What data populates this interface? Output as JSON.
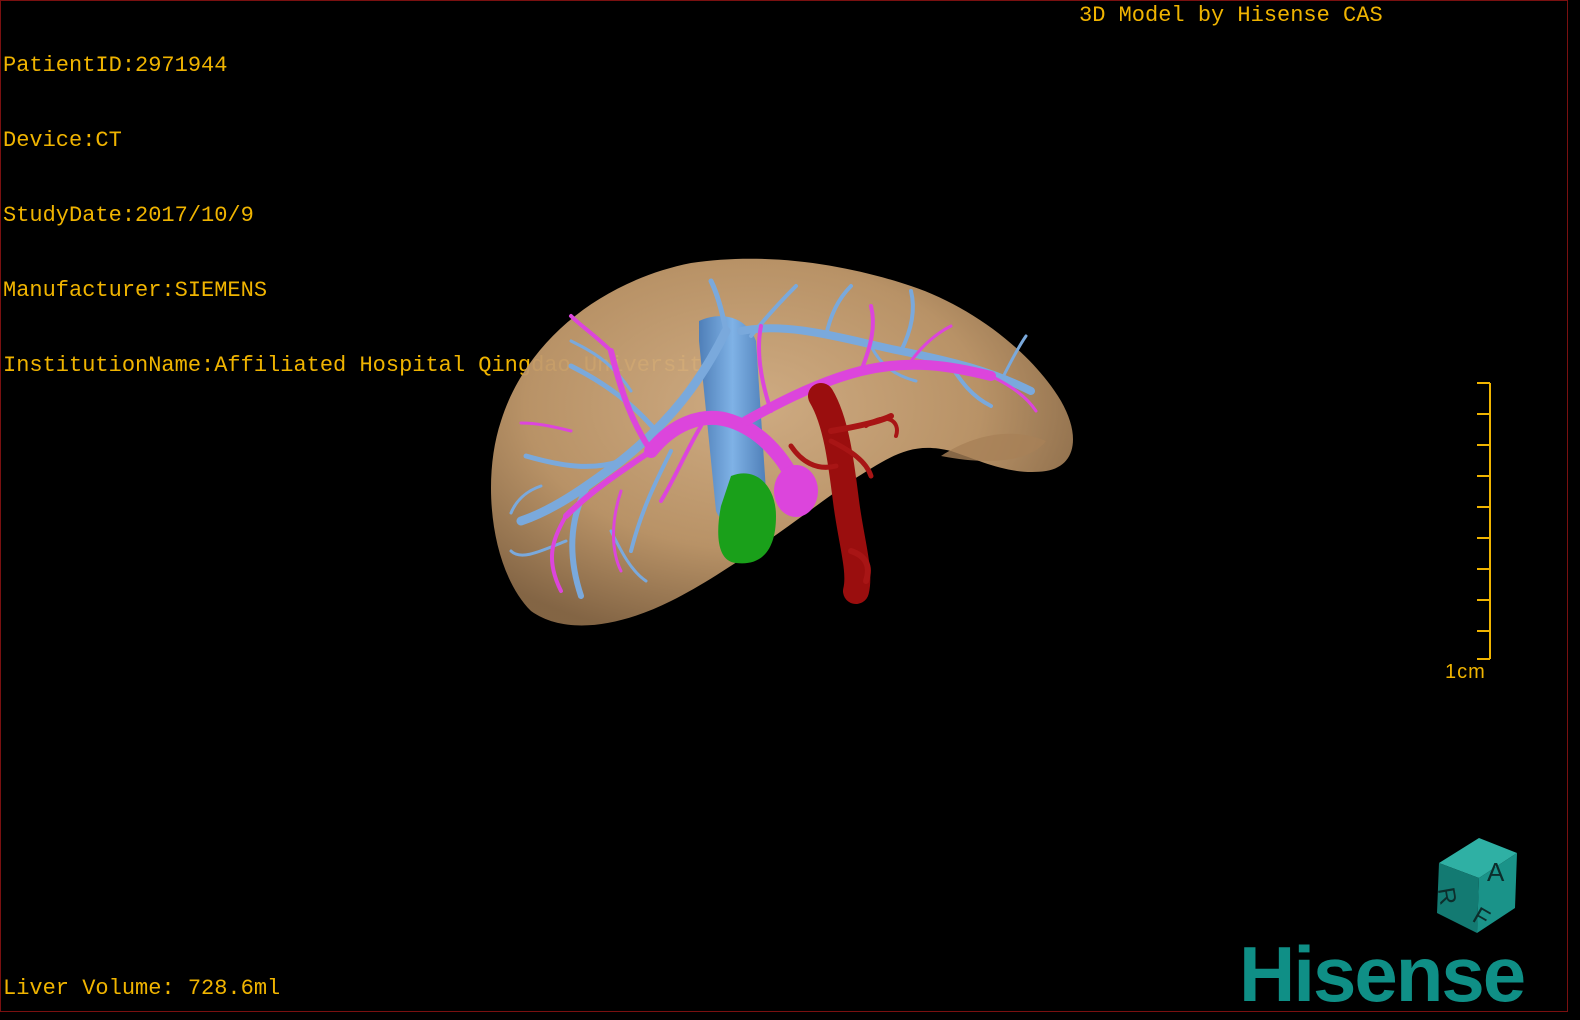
{
  "header": {
    "patient_id": "PatientID:2971944",
    "device": "Device:CT",
    "study_date": "StudyDate:2017/10/9",
    "manufacturer": "Manufacturer:SIEMENS",
    "institution": "InstitutionName:Affiliated Hospital Qingdao University-C"
  },
  "credit": "3D Model by Hisense CAS",
  "footer": {
    "liver_volume": "Liver Volume: 728.6ml"
  },
  "scale": {
    "label": "1cm",
    "color": "#f0b400"
  },
  "orientation_cube": {
    "labels": [
      "A",
      "R",
      "F"
    ],
    "color": "#1a8f86"
  },
  "logo": {
    "text": "Hisense",
    "color": "#0f8f86"
  },
  "model_colors": {
    "liver": "#c9a378",
    "hepatic_vein": "#6b9ed4",
    "portal_vein": "#d83fd8",
    "artery": "#9a0e0e",
    "gallbladder": "#1aa01a"
  },
  "text_color": "#f0b400"
}
